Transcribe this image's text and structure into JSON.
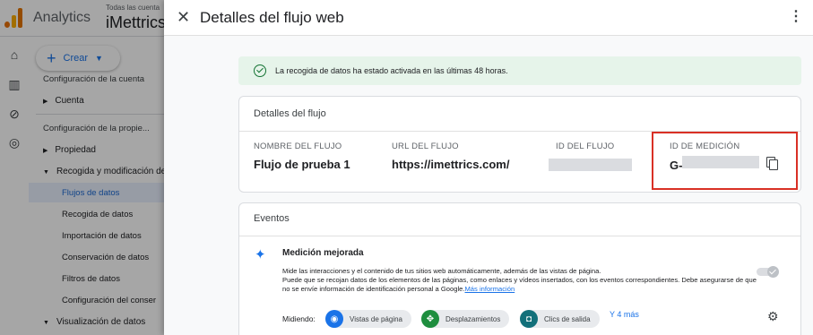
{
  "app": {
    "name": "Analytics",
    "account_small": "Todas las cuenta",
    "account_name": "iMettrics"
  },
  "sidebar": {
    "create_label": "Crear",
    "account_config": "Configuración de la cuenta",
    "account": "Cuenta",
    "property_config": "Configuración de la propie...",
    "property": "Propiedad",
    "collection": "Recogida y modificación de",
    "subitems": [
      "Flujos de datos",
      "Recogida de datos",
      "Importación de datos",
      "Conservación de datos",
      "Filtros de datos",
      "Configuración del conser"
    ],
    "visualization": "Visualización de datos"
  },
  "panel": {
    "title": "Detalles del flujo web",
    "banner": "La recogida de datos ha estado activada en las últimas 48 horas.",
    "details": {
      "title": "Detalles del flujo",
      "name_label": "NOMBRE DEL FLUJO",
      "name_value": "Flujo de prueba 1",
      "url_label": "URL DEL FLUJO",
      "url_value": "https://imettrics.com/",
      "id_label": "ID DEL FLUJO",
      "measurement_label": "ID DE MEDICIÓN",
      "measurement_prefix": "G-"
    },
    "events": {
      "title": "Eventos",
      "enhanced_title": "Medición mejorada",
      "desc": "Mide las interacciones y el contenido de tus sitios web automáticamente, además de las vistas de página.",
      "desc_sub": "Puede que se recojan datos de los elementos de las páginas, como enlaces y vídeos insertados, con los eventos correspondientes. Debe asegurarse de que no se envíe información de identificación personal a Google.",
      "more_info": "Más información",
      "measuring_label": "Midiendo:",
      "chips": [
        "Vistas de página",
        "Desplazamientos",
        "Clics de salida"
      ],
      "more": "Y 4 más"
    }
  },
  "colors": {
    "accent": "#1a73e8",
    "highlight": "#d93025",
    "success": "#137333"
  }
}
